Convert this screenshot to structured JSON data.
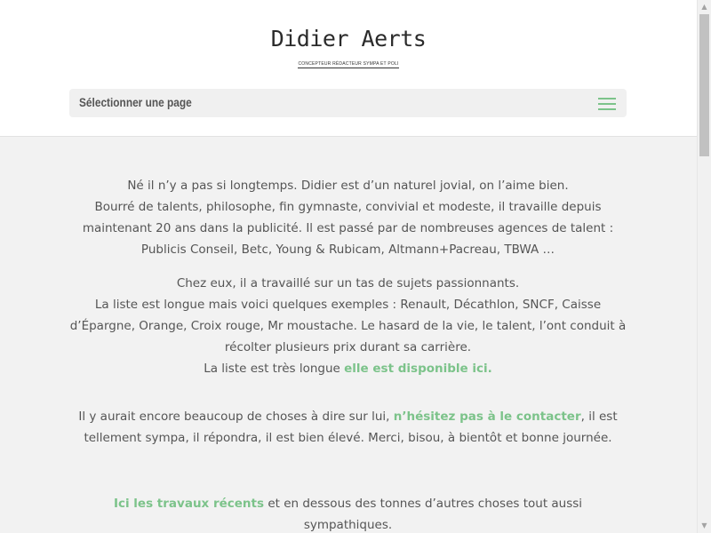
{
  "header": {
    "logo_title": "Didier Aerts",
    "logo_subtitle": "CONCEPTEUR RÉDACTEUR SYMPA ET POLI",
    "menu_label": "Sélectionner une page",
    "menu_icon": "hamburger-icon"
  },
  "content": {
    "p1": [
      "Né il n’y a pas si longtemps. Didier est d’un naturel jovial, on l’aime bien.",
      "Bourré de talents, philosophe, fin gymnaste, convivial et modeste, il travaille depuis maintenant 20 ans dans la publicité. Il est passé par de nombreuses agences de talent : Publicis Conseil, Betc, Young & Rubicam, Altmann+Pacreau, TBWA …"
    ],
    "p2": [
      "Chez eux, il a travaillé sur un tas de sujets passionnants.",
      "La liste est longue mais voici quelques exemples : Renault, Décathlon, SNCF, Caisse d’Épargne, Orange, Croix rouge, Mr moustache. Le hasard de la vie, le talent, l’ont conduit à récolter plusieurs prix durant sa carrière."
    ],
    "p2_last_prefix": "La liste est très longue ",
    "p2_link": "elle est disponible ici.",
    "p3_prefix": "Il y aurait encore beaucoup de choses à dire sur lui, ",
    "p3_link": "n’hésitez pas à le contacter",
    "p3_suffix": ", il est tellement sympa, il répondra, il est bien élevé. Merci, bisou, à bientôt et bonne journée.",
    "p4_link": "Ici les travaux récents",
    "p4_suffix": " et en dessous des tonnes d’autres choses tout aussi sympathiques."
  },
  "colors": {
    "accent": "#7cc38a",
    "text": "#555555",
    "background": "#f2f2f2",
    "header_bg": "#ffffff"
  }
}
